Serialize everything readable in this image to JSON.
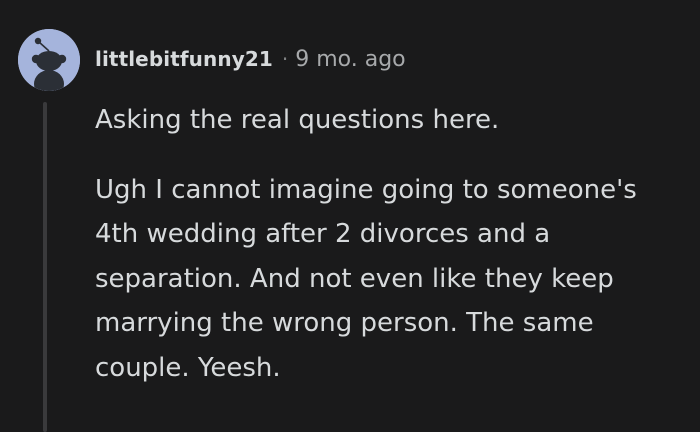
{
  "comment": {
    "author": "littlebitfunny21",
    "separator": "·",
    "timestamp": "9 mo. ago",
    "paragraphs": [
      "Asking the real questions here.",
      "Ugh I cannot imagine going to someone's 4th wedding after 2 divorces and a separation. And not even like they keep marrying the wrong person. The same couple. Yeesh."
    ]
  },
  "colors": {
    "background": "#1a1a1b",
    "avatar_bg": "#a5b4dc",
    "avatar_figure": "#2b2f36",
    "text": "#d7dadc",
    "muted": "#818384"
  },
  "icons": {
    "avatar": "reddit-snoo-avatar-icon"
  }
}
